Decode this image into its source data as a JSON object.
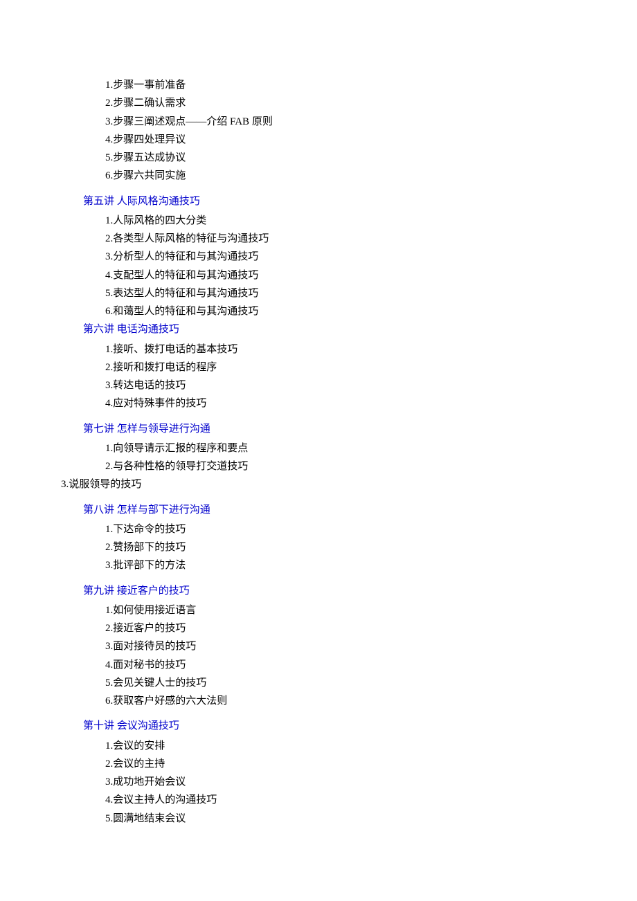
{
  "intro": {
    "items": [
      "1.步骤一事前准备",
      "2.步骤二确认需求",
      "3.步骤三阐述观点——介绍 FAB 原则",
      "4.步骤四处理异议",
      "5.步骤五达成协议",
      "6.步骤六共同实施"
    ]
  },
  "sections": [
    {
      "title": "第五讲  人际风格沟通技巧",
      "items": [
        "1.人际风格的四大分类",
        "2.各类型人际风格的特征与沟通技巧",
        "3.分析型人的特征和与其沟通技巧",
        "4.支配型人的特征和与其沟通技巧",
        "5.表达型人的特征和与其沟通技巧",
        "6.和蔼型人的特征和与其沟通技巧"
      ],
      "spaced": true
    },
    {
      "title": "第六讲  电话沟通技巧",
      "items": [
        "1.接听、拨打电话的基本技巧",
        "2.接听和拨打电话的程序",
        "3.转达电话的技巧",
        "4.应对特殊事件的技巧"
      ],
      "spaced": false
    },
    {
      "title": "第七讲  怎样与领导进行沟通",
      "items": [
        "1.向领导请示汇报的程序和要点",
        "2.与各种性格的领导打交道技巧"
      ],
      "outdent_items": [
        "3.说服领导的技巧"
      ],
      "spaced": true
    },
    {
      "title": "第八讲  怎样与部下进行沟通",
      "items": [
        "1.下达命令的技巧",
        "2.赞扬部下的技巧",
        "3.批评部下的方法"
      ],
      "spaced": true
    },
    {
      "title": "第九讲  接近客户的技巧",
      "items": [
        "1.如何使用接近语言",
        "2.接近客户的技巧",
        "3.面对接待员的技巧",
        "4.面对秘书的技巧",
        "5.会见关键人士的技巧",
        "6.获取客户好感的六大法则"
      ],
      "spaced": true
    },
    {
      "title": "第十讲  会议沟通技巧",
      "items": [
        "1.会议的安排",
        "2.会议的主持",
        "3.成功地开始会议",
        "4.会议主持人的沟通技巧",
        "5.圆满地结束会议"
      ],
      "spaced": true
    }
  ]
}
